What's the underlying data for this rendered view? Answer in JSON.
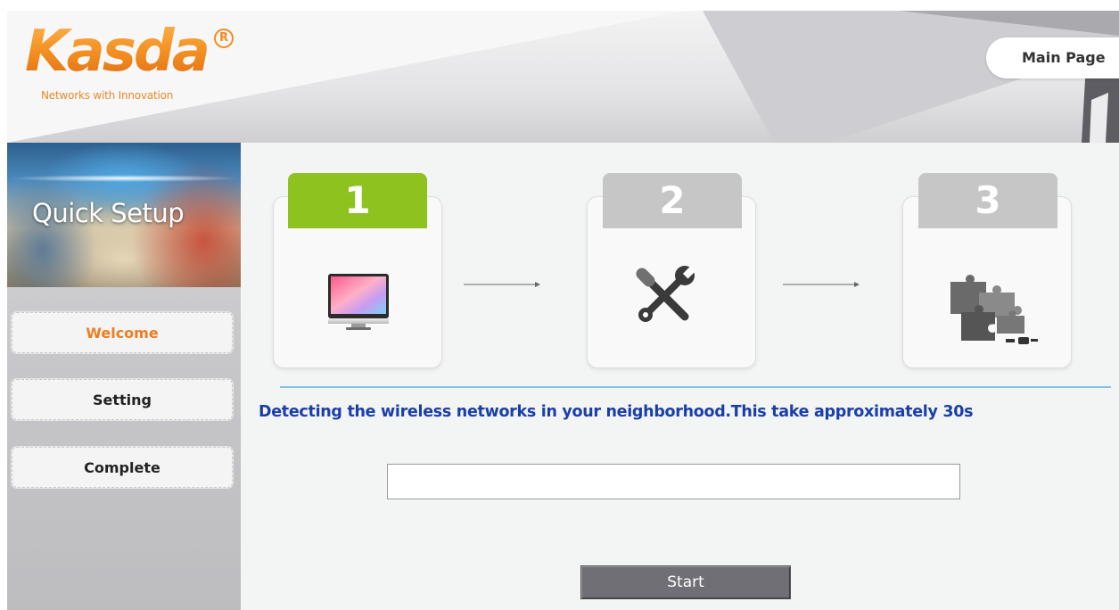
{
  "header": {
    "logo_text": "Kasda",
    "logo_registered": "R",
    "tagline": "Networks with Innovation",
    "main_page_label": "Main Page"
  },
  "sidebar": {
    "banner_title": "Quick Setup",
    "items": [
      {
        "label": "Welcome",
        "active": true
      },
      {
        "label": "Setting",
        "active": false
      },
      {
        "label": "Complete",
        "active": false
      }
    ]
  },
  "steps": [
    {
      "number": "1",
      "icon": "monitor-icon",
      "active": true
    },
    {
      "number": "2",
      "icon": "tools-icon",
      "active": false
    },
    {
      "number": "3",
      "icon": "puzzle-icon",
      "active": false
    }
  ],
  "main": {
    "detect_message": "Detecting the wireless networks in your neighborhood.This take approximately 30s",
    "progress_percent": 0,
    "start_label": "Start"
  },
  "colors": {
    "brand_orange": "#f28c1e",
    "step_active": "#8dc21f",
    "step_inactive": "#c6c6c6",
    "message_blue": "#1a3faa",
    "divider": "#7fc5e8"
  }
}
